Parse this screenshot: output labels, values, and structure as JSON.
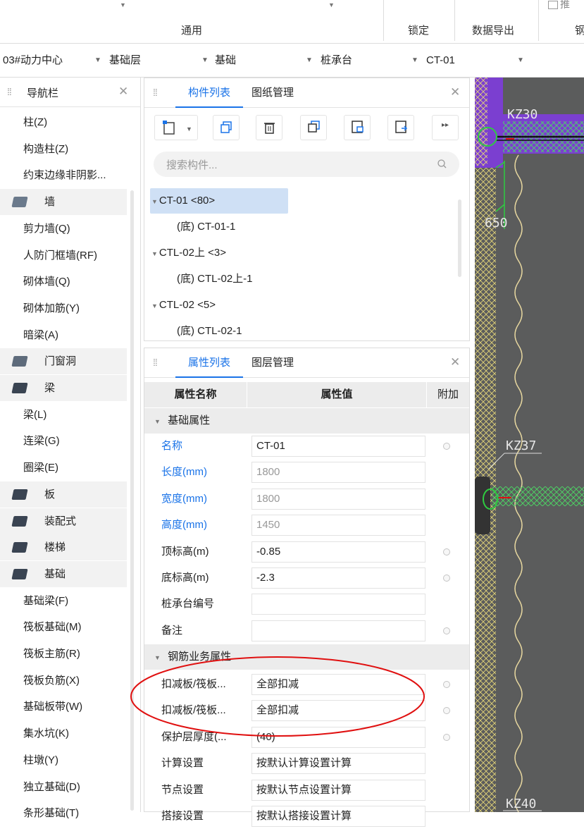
{
  "ribbon": {
    "groups": [
      {
        "label": "通用"
      },
      {
        "label": "锁定"
      },
      {
        "label": "数据导出"
      },
      {
        "label": "钢"
      }
    ],
    "top_right_label": "推"
  },
  "selector_bar": {
    "items": [
      "03#动力中心",
      "基础层",
      "基础",
      "桩承台",
      "CT-01"
    ]
  },
  "nav": {
    "title": "导航栏",
    "items": [
      {
        "label": "柱(Z)",
        "type": "item"
      },
      {
        "label": "构造柱(Z)",
        "type": "item"
      },
      {
        "label": "约束边缘非阴影...",
        "type": "item"
      },
      {
        "label": "墙",
        "type": "category",
        "icon": "wall-icon"
      },
      {
        "label": "剪力墙(Q)",
        "type": "item"
      },
      {
        "label": "人防门框墙(RF)",
        "type": "item"
      },
      {
        "label": "砌体墙(Q)",
        "type": "item"
      },
      {
        "label": "砌体加筋(Y)",
        "type": "item"
      },
      {
        "label": "暗梁(A)",
        "type": "item"
      },
      {
        "label": "门窗洞",
        "type": "category",
        "icon": "door-window-icon"
      },
      {
        "label": "梁",
        "type": "category",
        "icon": "beam-icon"
      },
      {
        "label": "梁(L)",
        "type": "item"
      },
      {
        "label": "连梁(G)",
        "type": "item"
      },
      {
        "label": "圈梁(E)",
        "type": "item"
      },
      {
        "label": "板",
        "type": "category",
        "icon": "slab-icon"
      },
      {
        "label": "装配式",
        "type": "category",
        "icon": "prefab-icon"
      },
      {
        "label": "楼梯",
        "type": "category",
        "icon": "stair-icon"
      },
      {
        "label": "基础",
        "type": "category",
        "icon": "foundation-icon"
      },
      {
        "label": "基础梁(F)",
        "type": "item"
      },
      {
        "label": "筏板基础(M)",
        "type": "item"
      },
      {
        "label": "筏板主筋(R)",
        "type": "item"
      },
      {
        "label": "筏板负筋(X)",
        "type": "item"
      },
      {
        "label": "基础板带(W)",
        "type": "item"
      },
      {
        "label": "集水坑(K)",
        "type": "item"
      },
      {
        "label": "柱墩(Y)",
        "type": "item"
      },
      {
        "label": "独立基础(D)",
        "type": "item"
      },
      {
        "label": "条形基础(T)",
        "type": "item"
      }
    ]
  },
  "component_panel": {
    "tabs": [
      "构件列表",
      "图纸管理"
    ],
    "search_placeholder": "搜索构件...",
    "tree": [
      {
        "label": "CT-01 <80>",
        "level": 0,
        "selected": true
      },
      {
        "label": "(底) CT-01-1",
        "level": 1
      },
      {
        "label": "CTL-02上 <3>",
        "level": 0
      },
      {
        "label": "(底) CTL-02上-1",
        "level": 1
      },
      {
        "label": "CTL-02 <5>",
        "level": 0
      },
      {
        "label": "(底) CTL-02-1",
        "level": 1
      }
    ]
  },
  "property_panel": {
    "tabs": [
      "属性列表",
      "图层管理"
    ],
    "headers": {
      "name": "属性名称",
      "value": "属性值",
      "extra": "附加"
    },
    "group1": "基础属性",
    "rows1": [
      {
        "name": "名称",
        "value": "CT-01",
        "blue": true,
        "grey": false,
        "dot": true
      },
      {
        "name": "长度(mm)",
        "value": "1800",
        "blue": true,
        "grey": true,
        "dot": false
      },
      {
        "name": "宽度(mm)",
        "value": "1800",
        "blue": true,
        "grey": true,
        "dot": false
      },
      {
        "name": "高度(mm)",
        "value": "1450",
        "blue": true,
        "grey": true,
        "dot": false
      },
      {
        "name": "顶标高(m)",
        "value": "-0.85",
        "blue": false,
        "grey": false,
        "dot": true
      },
      {
        "name": "底标高(m)",
        "value": "-2.3",
        "blue": false,
        "grey": false,
        "dot": true
      },
      {
        "name": "桩承台编号",
        "value": "",
        "blue": false,
        "grey": false,
        "dot": false
      },
      {
        "name": "备注",
        "value": "",
        "blue": false,
        "grey": false,
        "dot": true
      }
    ],
    "group2": "钢筋业务属性",
    "rows2": [
      {
        "name": "扣减板/筏板...",
        "value": "全部扣减",
        "dot": true
      },
      {
        "name": "扣减板/筏板...",
        "value": "全部扣减",
        "dot": true
      },
      {
        "name": "保护层厚度(...",
        "value": "(40)",
        "dot": true
      },
      {
        "name": "计算设置",
        "value": "按默认计算设置计算",
        "dot": false
      },
      {
        "name": "节点设置",
        "value": "按默认节点设置计算",
        "dot": false
      },
      {
        "name": "搭接设置",
        "value": "按默认搭接设置计算",
        "dot": false
      }
    ]
  },
  "drawing": {
    "labels": [
      "KZ30",
      "650",
      "KZ37",
      "KZ40"
    ],
    "colors": {
      "background": "#5b5c5c",
      "purple": "#7b3fd0",
      "hatch": "#e8d878",
      "green": "#2ecc40",
      "annotation": "#e01010"
    }
  }
}
